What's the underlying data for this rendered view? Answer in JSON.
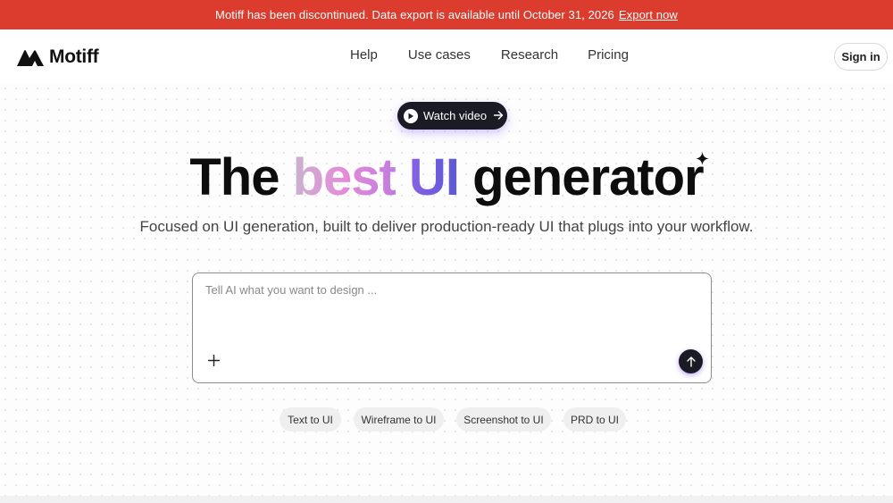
{
  "banner": {
    "message": "Motiff has been discontinued. Data export is available until October 31, 2026",
    "link": "Export now"
  },
  "nav": {
    "logo_text": "Motiff",
    "links": [
      "Help",
      "Use cases",
      "Research",
      "Pricing"
    ],
    "signin": "Sign in"
  },
  "hero": {
    "watch_video": "Watch video",
    "headline": {
      "part1": "The ",
      "part2": "best",
      "part3": " ",
      "part4": "UI",
      "part5": " generator"
    },
    "subtitle": "Focused on UI generation, built to deliver production-ready UI that plugs into your workflow.",
    "prompt_placeholder": "Tell AI what you want to design ...",
    "chips": [
      "Text to UI",
      "Wireframe to UI",
      "Screenshot to UI",
      "PRD to UI"
    ]
  },
  "icons": {
    "logo": "motiff-logo-icon",
    "play": "play-icon",
    "arrow": "arrow-right-icon",
    "sparkle": "sparkle-icon",
    "plus": "plus-icon",
    "send": "arrow-up-icon"
  },
  "colors": {
    "banner_bg": "#dc3c2e",
    "button_dark": "#1b1b26",
    "accent_purple": "#8a61e6",
    "accent_pink": "#e58bd9"
  }
}
